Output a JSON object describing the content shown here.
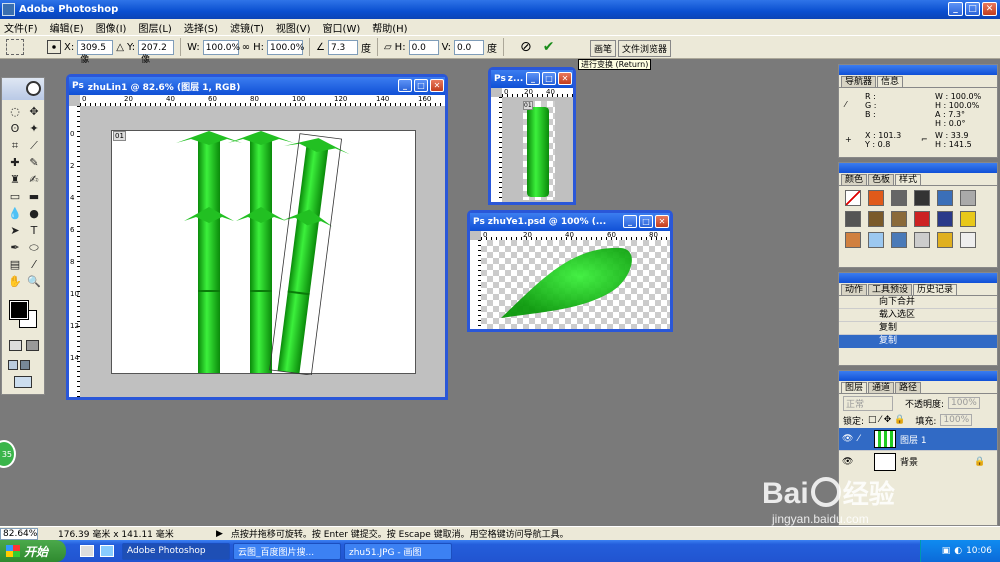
{
  "app": {
    "title": "Adobe Photoshop"
  },
  "menu": [
    "文件(F)",
    "编辑(E)",
    "图像(I)",
    "图层(L)",
    "选择(S)",
    "滤镜(T)",
    "视图(V)",
    "窗口(W)",
    "帮助(H)"
  ],
  "options": {
    "x_label": "X:",
    "x_value": "309.5 像",
    "y_label": "Y:",
    "y_value": "207.2 像",
    "w_label": "W:",
    "w_value": "100.0%",
    "h_label": "H:",
    "h_value": "100.0%",
    "angle_value": "7.3",
    "angle_unit": "度",
    "hskew_label": "H:",
    "hskew_value": "0.0",
    "vskew_label": "V:",
    "vskew_value": "0.0",
    "skew_unit": "度"
  },
  "palette_well": [
    "画笔",
    "文件浏览器"
  ],
  "tooltip": "进行变换 (Return)",
  "doc1": {
    "title": "zhuLin1 @ 82.6% (图层 1, RGB)",
    "ruler_h": [
      "0",
      "20",
      "40",
      "60",
      "80",
      "100",
      "120",
      "140",
      "160"
    ],
    "ruler_v": [
      "0",
      "2",
      "4",
      "6",
      "8",
      "10",
      "12",
      "14"
    ],
    "layer_tag": "01"
  },
  "doc2": {
    "title": "z...",
    "ruler_h": [
      "0",
      "20",
      "40"
    ],
    "layer_tag": "01"
  },
  "doc3": {
    "title": "zhuYe1.psd @ 100% (...",
    "ruler_h": [
      "0",
      "20",
      "40",
      "60",
      "80"
    ]
  },
  "navigator": {
    "tabs": [
      "导航器",
      "信息"
    ],
    "r": "R :",
    "g": "G :",
    "b": "B :",
    "w_pct": "W : 100.0%",
    "h_pct": "H : 100.0%",
    "a": "A :   7.3°",
    "h_deg": "H :   0.0°",
    "x": "X :  101.3",
    "y": "Y :    0.8",
    "w": "W :   33.9",
    "h": "H :  141.5"
  },
  "colors_panel": {
    "tabs": [
      "颜色",
      "色板",
      "样式"
    ]
  },
  "history": {
    "tabs": [
      "动作",
      "工具预设",
      "历史记录"
    ],
    "items": [
      "向下合并",
      "载入选区",
      "复制",
      "复制"
    ]
  },
  "layers": {
    "tabs": [
      "图层",
      "通道",
      "路径"
    ],
    "blend": "正常",
    "opacity_label": "不透明度:",
    "opacity": "100%",
    "lock_label": "锁定:",
    "fill_label": "填充:",
    "fill": "100%",
    "items": [
      "图层 1",
      "背景"
    ]
  },
  "status": {
    "zoom": "82.64%",
    "size": "176.39 毫米 x 141.11 毫米",
    "hint": "点按并拖移可旋转。按 Enter 键提交。按 Escape 键取消。用空格键访问导航工具。"
  },
  "taskbar": {
    "start": "开始",
    "tasks": [
      "Adobe Photoshop",
      "云图_百度图片搜...",
      "zhu51.JPG - 画图"
    ],
    "clock": "10:06"
  },
  "watermark": {
    "brand": "Bai",
    "sub": "经验",
    "url": "jingyan.baidu.com"
  },
  "badge": "35",
  "colors": {
    "accent": "#2a57d8",
    "bamboo": "#16c016",
    "history_selected": "#316ac5"
  }
}
